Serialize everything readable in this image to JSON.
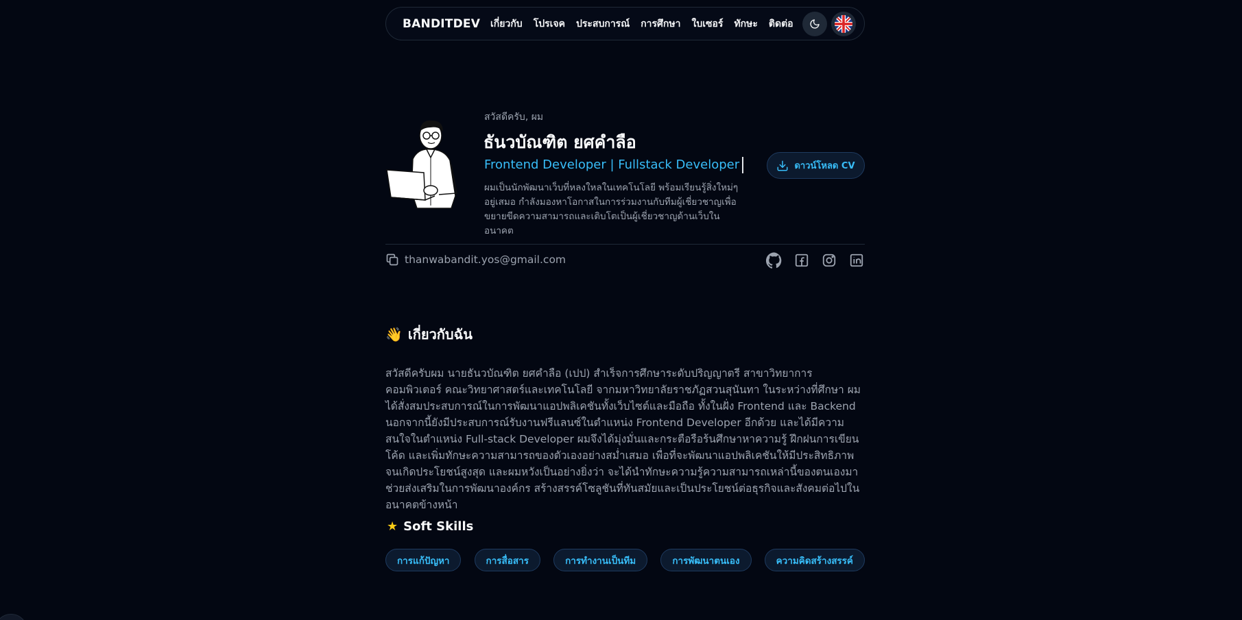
{
  "nav": {
    "brand": "BANDITDEV",
    "links": [
      "เกี่ยวกับ",
      "โปรเจค",
      "ประสบการณ์",
      "การศึกษา",
      "ใบเซอร์",
      "ทักษะ",
      "ติดต่อ"
    ],
    "theme_icon": "moon-icon",
    "language_icon": "uk-flag-icon"
  },
  "hero": {
    "greeting": "สวัสดีครับ, ผม",
    "name": "ธันวบัณฑิต ยศคำลือ",
    "role": "Frontend Developer | Fullstack Developer",
    "bio": "ผมเป็นนักพัฒนาเว็บที่หลงใหลในเทคโนโลยี พร้อมเรียนรู้สิ่งใหม่ๆ อยู่เสมอ กำลังมองหาโอกาสในการร่วมงานกับทีมผู้เชี่ยวชาญเพื่อขยายขีดความสามารถและเติบโตเป็นผู้เชี่ยวชาญด้านเว็บในอนาคต",
    "cv_button": "ดาวน์โหลด CV"
  },
  "contact": {
    "email": "thanwabandit.yos@gmail.com",
    "socials": [
      "github-icon",
      "facebook-icon",
      "instagram-icon",
      "linkedin-icon"
    ]
  },
  "about": {
    "emoji": "👋",
    "title": "เกี่ยวกับฉัน",
    "text": "สวัสดีครับผม นายธันวบัณฑิต ยศคำลือ (เปป) สำเร็จการศึกษาระดับปริญญาตรี สาขาวิทยาการคอมพิวเตอร์ คณะวิทยาศาสตร์และเทคโนโลยี จากมหาวิทยาลัยราชภัฏสวนสุนันทา ในระหว่างที่ศึกษา ผมได้สั่งสมประสบการณ์ในการพัฒนาแอปพลิเคชันทั้งเว็บไซต์และมือถือ ทั้งในฝั่ง Frontend และ Backend นอกจากนี้ยังมีประสบการณ์รับงานฟรีแลนซ์ในตำแหน่ง Frontend Developer อีกด้วย และได้มีความสนใจในตำแหน่ง Full-stack Developer ผมจึงได้มุ่งมั่นและกระตือรือร้นศึกษาหาความรู้ ฝึกฝนการเขียนโค้ด และเพิ่มทักษะความสามารถของตัวเองอย่างสม่ำเสมอ เพื่อที่จะพัฒนาแอปพลิเคชันให้มีประสิทธิภาพจนเกิดประโยชน์สูงสุด และผมหวังเป็นอย่างยิ่งว่า จะได้นำทักษะความรู้ความสามารถเหล่านี้ของตนเองมาช่วยส่งเสริมในการพัฒนาองค์กร สร้างสรรค์โซลูชันที่ทันสมัยและเป็นประโยชน์ต่อธุรกิจและสังคมต่อไปในอนาคตข้างหน้า"
  },
  "soft_skills": {
    "title": "Soft Skills",
    "items": [
      "การแก้ปัญหา",
      "การสื่อสาร",
      "การทำงานเป็นทีม",
      "การพัฒนาตนเอง",
      "ความคิดสร้างสรรค์"
    ]
  },
  "colors": {
    "background": "#030712",
    "accent": "#38bdf8",
    "muted_text": "#9ca3af",
    "star": "#facc15"
  }
}
